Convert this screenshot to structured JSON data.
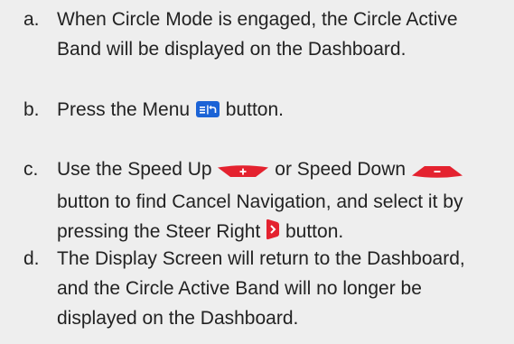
{
  "colors": {
    "background": "#eeeeee",
    "text": "#222222",
    "menu_icon_fill": "#1b63d6",
    "control_red": "#e4222f",
    "control_symbol": "#ffffff"
  },
  "steps": [
    {
      "letter": "a.",
      "line1": "When Circle Mode is engaged, the Circle Active",
      "line2": "Band will be displayed on the Dashboard."
    },
    {
      "letter": "b.",
      "before_icon": "Press the Menu",
      "icon": "menu-button-icon",
      "after_icon": "button."
    },
    {
      "letter": "c.",
      "line1_before_icon1": "Use the Speed Up",
      "icon1": "speed-up-button-icon",
      "line1_between_icons": "or Speed Down",
      "icon2": "speed-down-button-icon",
      "line2": "button to find Cancel Navigation, and select it by",
      "line3_before_icon": "pressing the Steer Right",
      "icon3": "steer-right-button-icon",
      "line3_after_icon": "button."
    },
    {
      "letter": "d.",
      "line1": "The Display Screen will return to the Dashboard,",
      "line2": "and the Circle Active Band will no longer be",
      "line3": "displayed on the Dashboard."
    }
  ]
}
